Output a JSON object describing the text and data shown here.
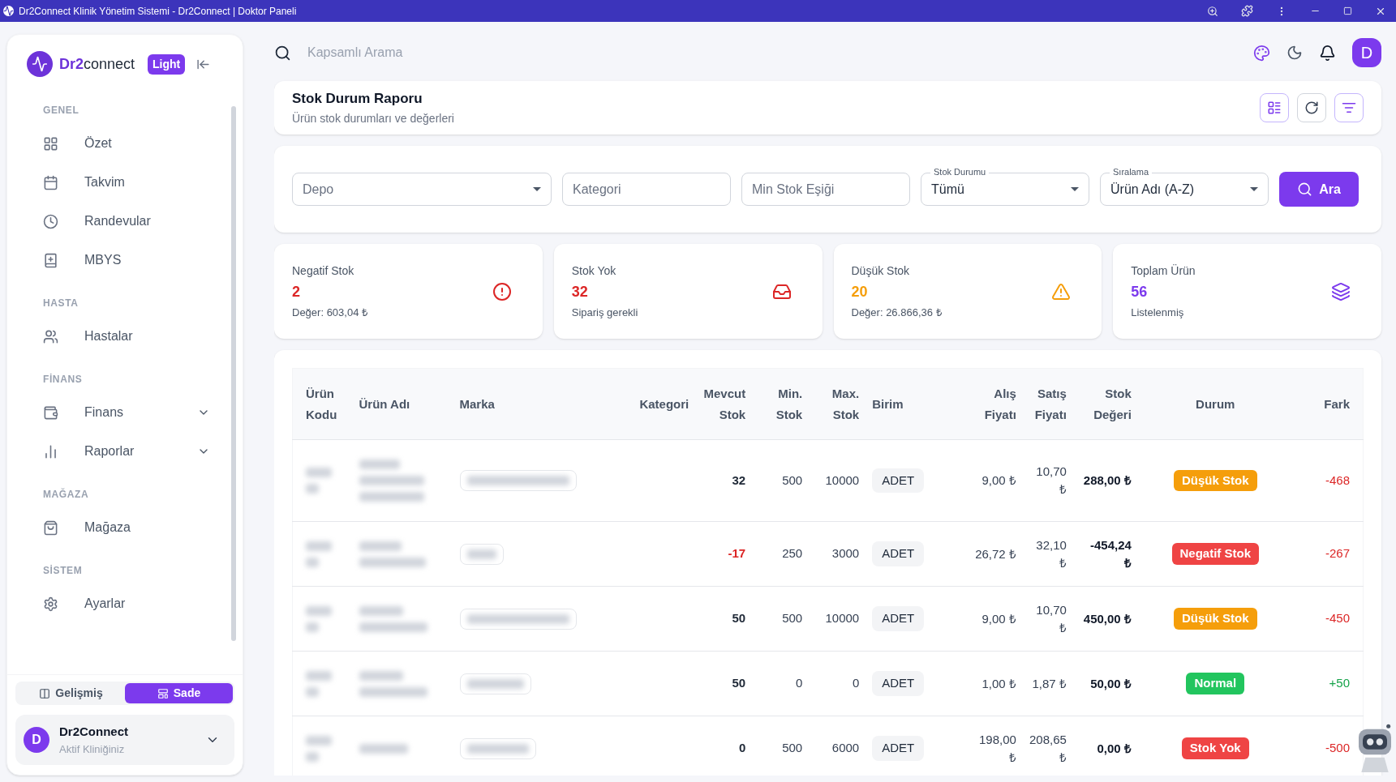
{
  "title_bar": {
    "title": "Dr2Connect Klinik Yönetim Sistemi - Dr2Connect | Doktor Paneli"
  },
  "sidebar": {
    "brand": {
      "accent": "Dr2",
      "rest": "connect"
    },
    "badge": "Light",
    "sections": [
      {
        "label": "GENEL",
        "items": [
          {
            "label": "Özet"
          },
          {
            "label": "Takvim"
          },
          {
            "label": "Randevular"
          },
          {
            "label": "MBYS"
          }
        ]
      },
      {
        "label": "HASTA",
        "items": [
          {
            "label": "Hastalar"
          }
        ]
      },
      {
        "label": "FİNANS",
        "items": [
          {
            "label": "Finans",
            "expanded": false
          },
          {
            "label": "Raporlar",
            "expanded": false
          }
        ]
      },
      {
        "label": "MAĞAZA",
        "items": [
          {
            "label": "Mağaza"
          }
        ]
      },
      {
        "label": "SİSTEM",
        "items": [
          {
            "label": "Ayarlar"
          }
        ]
      }
    ],
    "view_toggle": [
      {
        "label": "Gelişmiş",
        "selected": false
      },
      {
        "label": "Sade",
        "selected": true
      }
    ],
    "clinic": {
      "initial": "D",
      "name": "Dr2Connect",
      "subtitle": "Aktif Kliniğiniz"
    }
  },
  "top_bar": {
    "search": {
      "placeholder": "Kapsamlı Arama"
    },
    "avatar": "D"
  },
  "report": {
    "title": "Stok Durum Raporu",
    "subtitle": "Ürün stok durumları ve değerleri"
  },
  "filters": [
    {
      "kind": "select",
      "placeholder": "Depo"
    },
    {
      "kind": "input",
      "placeholder": "Kategori"
    },
    {
      "kind": "input",
      "placeholder": "Min Stok Eşiği"
    },
    {
      "kind": "select",
      "label": "Stok Durumu",
      "value": "Tümü"
    },
    {
      "kind": "select",
      "label": "Sıralama",
      "value": "Ürün Adı (A-Z)"
    }
  ],
  "search_button": "Ara",
  "stats": [
    {
      "label": "Negatif Stok",
      "value": "2",
      "note": "Değer: 603,04 ₺",
      "color": "#dc2626"
    },
    {
      "label": "Stok Yok",
      "value": "32",
      "note": "Sipariş gerekli",
      "color": "#dc2626"
    },
    {
      "label": "Düşük Stok",
      "value": "20",
      "note": "Değer: 26.866,36 ₺",
      "color": "#f59e0b"
    },
    {
      "label": "Toplam Ürün",
      "value": "56",
      "note": "Listelenmiş",
      "color": "#7c3aed"
    }
  ],
  "table": {
    "columns": [
      {
        "label": "Ürün Kodu"
      },
      {
        "label": "Ürün Adı"
      },
      {
        "label": "Marka"
      },
      {
        "label": "Kategori"
      },
      {
        "label": "Mevcut Stok"
      },
      {
        "label": "Min. Stok"
      },
      {
        "label": "Max. Stok"
      },
      {
        "label": "Birim"
      },
      {
        "label": "Alış Fiyatı"
      },
      {
        "label": "Satış Fiyatı"
      },
      {
        "label": "Stok Değeri"
      },
      {
        "label": "Durum"
      },
      {
        "label": "Fark"
      }
    ],
    "rows": [
      {
        "stock": {
          "text": "32",
          "color": "#1f2937"
        },
        "min": "500",
        "max": "10000",
        "unit": "ADET",
        "buy": "9,00 ₺",
        "sell": "10,70 ₺",
        "value": "288,00 ₺",
        "status": {
          "label": "Düşük Stok",
          "color": "#f59e0b"
        },
        "diff": {
          "text": "-468",
          "color": "#dc2626"
        }
      },
      {
        "stock": {
          "text": "-17",
          "color": "#dc2626"
        },
        "min": "250",
        "max": "3000",
        "unit": "ADET",
        "buy": "26,72 ₺",
        "sell": "32,10 ₺",
        "value": "-454,24 ₺",
        "status": {
          "label": "Negatif Stok",
          "color": "#ef4444"
        },
        "diff": {
          "text": "-267",
          "color": "#dc2626"
        }
      },
      {
        "stock": {
          "text": "50",
          "color": "#1f2937"
        },
        "min": "500",
        "max": "10000",
        "unit": "ADET",
        "buy": "9,00 ₺",
        "sell": "10,70 ₺",
        "value": "450,00 ₺",
        "status": {
          "label": "Düşük Stok",
          "color": "#f59e0b"
        },
        "diff": {
          "text": "-450",
          "color": "#dc2626"
        }
      },
      {
        "stock": {
          "text": "50",
          "color": "#1f2937"
        },
        "min": "0",
        "max": "0",
        "unit": "ADET",
        "buy": "1,00 ₺",
        "sell": "1,87 ₺",
        "value": "50,00 ₺",
        "status": {
          "label": "Normal",
          "color": "#22c55e"
        },
        "diff": {
          "text": "+50",
          "color": "#16a34a"
        }
      },
      {
        "stock": {
          "text": "0",
          "color": "#1f2937"
        },
        "min": "500",
        "max": "6000",
        "unit": "ADET",
        "buy": "198,00 ₺",
        "sell": "208,65 ₺",
        "value": "0,00 ₺",
        "status": {
          "label": "Stok Yok",
          "color": "#ef4444"
        },
        "diff": {
          "text": "-500",
          "color": "#dc2626"
        }
      }
    ]
  }
}
